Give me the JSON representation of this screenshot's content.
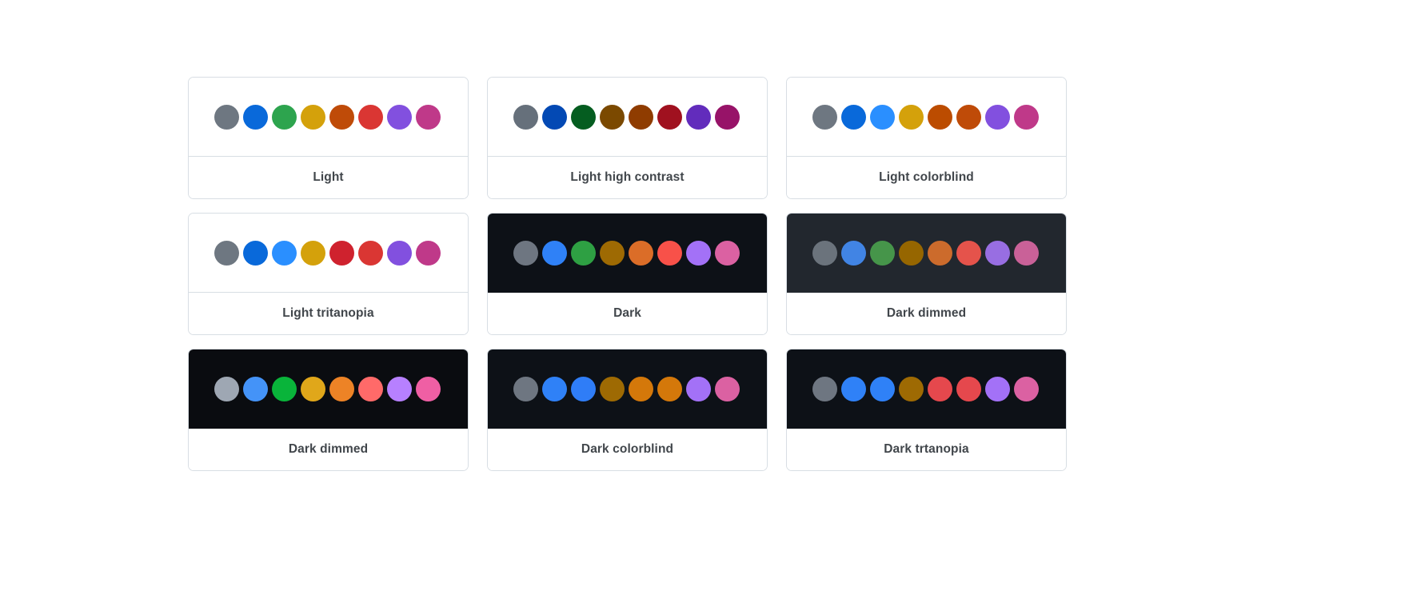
{
  "page": {
    "background": "#ffffff",
    "card_border_color": "#d8dee4",
    "label_color": "#41464b"
  },
  "themes": [
    {
      "label": "Light",
      "mode": "light",
      "background": "#ffffff",
      "swatches": [
        "#6e7781",
        "#0969da",
        "#2da44e",
        "#d4a10b",
        "#bf4b08",
        "#da3633",
        "#8250df",
        "#bf3989"
      ]
    },
    {
      "label": "Light high contrast",
      "mode": "light",
      "background": "#ffffff",
      "swatches": [
        "#66707b",
        "#0349b4",
        "#055d20",
        "#7b4900",
        "#8f3c00",
        "#a0111f",
        "#622cbc",
        "#971368"
      ]
    },
    {
      "label": "Light colorblind",
      "mode": "light",
      "background": "#ffffff",
      "swatches": [
        "#6e7781",
        "#0969da",
        "#2a8fff",
        "#d4a10b",
        "#bc4c00",
        "#bf4b08",
        "#8250df",
        "#bf3989"
      ]
    },
    {
      "label": "Light tritanopia",
      "mode": "light",
      "background": "#ffffff",
      "swatches": [
        "#6e7781",
        "#0969da",
        "#2a8fff",
        "#d4a10b",
        "#cf222e",
        "#da3633",
        "#8250df",
        "#bf3989"
      ]
    },
    {
      "label": "Dark",
      "mode": "dark",
      "background": "#0d1117",
      "swatches": [
        "#6e7681",
        "#2f81f7",
        "#2ea043",
        "#9e6a03",
        "#db6d28",
        "#f85149",
        "#a371f7",
        "#db61a2"
      ]
    },
    {
      "label": "Dark dimmed",
      "mode": "dark",
      "background": "#22272e",
      "swatches": [
        "#6b737c",
        "#4184e4",
        "#46954a",
        "#966600",
        "#cc6b2c",
        "#e5534b",
        "#986ee2",
        "#c96198"
      ]
    },
    {
      "label": "Dark dimmed",
      "mode": "dark",
      "background": "#0a0c10",
      "swatches": [
        "#9ea7b3",
        "#4493f8",
        "#09b43a",
        "#e0a71a",
        "#ed8326",
        "#ff6a69",
        "#b780ff",
        "#ef5fa4"
      ]
    },
    {
      "label": "Dark colorblind",
      "mode": "dark",
      "background": "#0d1117",
      "swatches": [
        "#6e7681",
        "#2f81f7",
        "#2f7df7",
        "#9e6a03",
        "#d4780a",
        "#d4780a",
        "#a371f7",
        "#db61a2"
      ]
    },
    {
      "label": "Dark trtanopia",
      "mode": "dark",
      "background": "#0d1117",
      "swatches": [
        "#6e7681",
        "#2f81f7",
        "#2f81f7",
        "#9e6a03",
        "#e5484d",
        "#e5484d",
        "#a371f7",
        "#db61a2"
      ]
    }
  ]
}
